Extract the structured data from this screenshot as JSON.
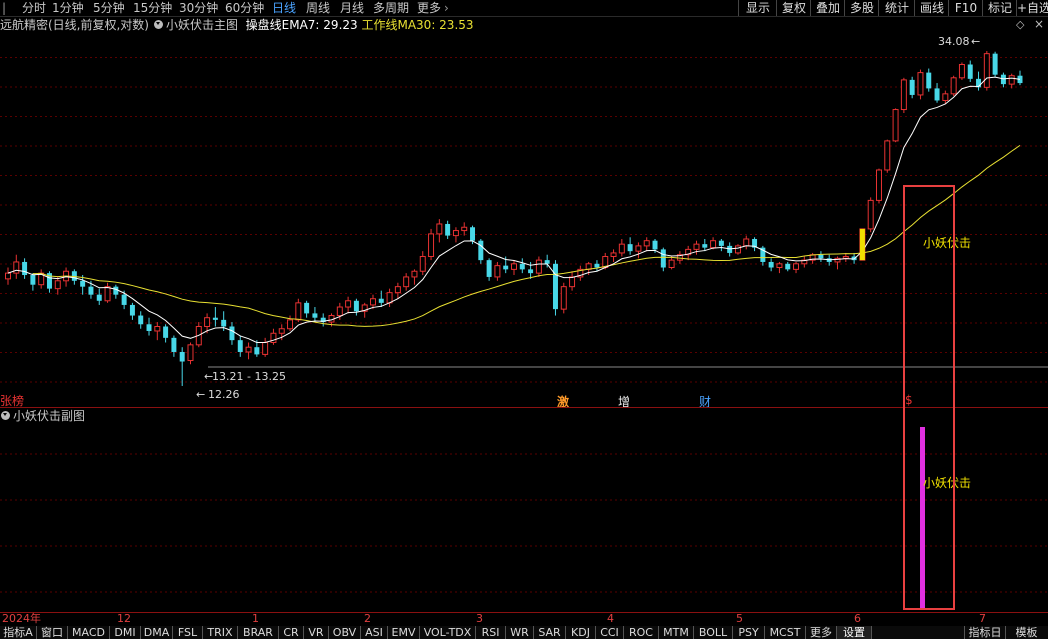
{
  "colors": {
    "up": "#e83232",
    "down": "#48d8e8",
    "ema": "#ffffff",
    "ma30": "#e8e032",
    "signal_magenta": "#e030e0",
    "signal_yellow": "#f0e000",
    "highlight_box": "#e84040",
    "grid": "#5a0000"
  },
  "topbar": {
    "periods": [
      "分时",
      "1分钟",
      "5分钟",
      "15分钟",
      "30分钟",
      "60分钟",
      "日线",
      "周线",
      "月线",
      "多周期",
      "更多"
    ],
    "active_period": "日线",
    "right_buttons": [
      "显示",
      "复权",
      "叠加",
      "多股",
      "统计",
      "画线",
      "F10",
      "标记",
      "+自选"
    ]
  },
  "info": {
    "stock": "远航精密(日线,前复权,对数)",
    "indicator": "小妖伏击主图",
    "ema_label": "操盘线EMA7: 29.23",
    "ma_label": "工作线MA30: 23.53"
  },
  "annotations": {
    "high": "34.08",
    "gap_range": "13.21 - 13.25",
    "low": "12.26",
    "signal_main": "小妖伏击",
    "signal_sub": "小妖伏击",
    "left_tag": "张榜",
    "markers": [
      "激",
      "增",
      "财",
      "$"
    ]
  },
  "subchart": {
    "title": "小妖伏击副图"
  },
  "dates": [
    "2024年",
    "12",
    "1",
    "2",
    "3",
    "4",
    "5",
    "6",
    "7"
  ],
  "bottom_tabs": [
    "指标A",
    "窗口",
    "MACD",
    "DMI",
    "DMA",
    "FSL",
    "TRIX",
    "BRAR",
    "CR",
    "VR",
    "OBV",
    "ASI",
    "EMV",
    "VOL-TDX",
    "RSI",
    "WR",
    "SAR",
    "KDJ",
    "CCI",
    "ROC",
    "MTM",
    "BOLL",
    "PSY",
    "MCST",
    "更多",
    "设置"
  ],
  "bottom_right": [
    "指标日",
    "模板"
  ],
  "chart_data": {
    "type": "candlestick",
    "scale": "log",
    "ylim": [
      12.0,
      36.0
    ],
    "series": [
      {
        "name": "操盘线EMA7",
        "last": 29.23
      },
      {
        "name": "工作线MA30",
        "last": 23.53
      }
    ],
    "candles": [
      [
        17.0,
        17.6,
        16.7,
        17.3
      ],
      [
        17.3,
        18.3,
        17.0,
        17.9
      ],
      [
        17.9,
        18.1,
        17.0,
        17.2
      ],
      [
        17.2,
        17.3,
        16.4,
        16.7
      ],
      [
        16.7,
        17.5,
        16.5,
        17.3
      ],
      [
        17.3,
        17.4,
        16.3,
        16.5
      ],
      [
        16.5,
        17.1,
        16.2,
        16.9
      ],
      [
        16.9,
        17.6,
        16.6,
        17.4
      ],
      [
        17.4,
        17.5,
        16.7,
        16.9
      ],
      [
        16.9,
        17.2,
        16.2,
        16.6
      ],
      [
        16.6,
        16.9,
        16.0,
        16.2
      ],
      [
        16.2,
        16.5,
        15.7,
        15.9
      ],
      [
        15.9,
        16.8,
        15.8,
        16.6
      ],
      [
        16.6,
        16.7,
        16.0,
        16.2
      ],
      [
        16.2,
        16.4,
        15.5,
        15.7
      ],
      [
        15.7,
        15.8,
        15.0,
        15.2
      ],
      [
        15.2,
        15.4,
        14.6,
        14.8
      ],
      [
        14.8,
        15.1,
        14.3,
        14.5
      ],
      [
        14.5,
        14.9,
        14.1,
        14.7
      ],
      [
        14.7,
        14.8,
        14.0,
        14.2
      ],
      [
        14.2,
        14.3,
        13.4,
        13.6
      ],
      [
        13.6,
        13.8,
        12.26,
        13.21
      ],
      [
        13.25,
        14.0,
        13.1,
        13.9
      ],
      [
        13.9,
        14.9,
        13.8,
        14.7
      ],
      [
        14.7,
        15.3,
        14.4,
        15.1
      ],
      [
        15.1,
        15.6,
        14.7,
        15.0
      ],
      [
        15.0,
        15.4,
        14.5,
        14.7
      ],
      [
        14.7,
        14.9,
        13.9,
        14.1
      ],
      [
        14.1,
        14.3,
        13.4,
        13.6
      ],
      [
        13.6,
        14.0,
        13.3,
        13.8
      ],
      [
        13.8,
        14.1,
        13.4,
        13.5
      ],
      [
        13.5,
        14.2,
        13.4,
        14.0
      ],
      [
        14.0,
        14.6,
        13.9,
        14.4
      ],
      [
        14.4,
        14.8,
        14.1,
        14.6
      ],
      [
        14.6,
        15.2,
        14.5,
        15.0
      ],
      [
        15.0,
        16.0,
        14.9,
        15.8
      ],
      [
        15.8,
        15.9,
        15.1,
        15.3
      ],
      [
        15.3,
        15.6,
        14.9,
        15.1
      ],
      [
        15.1,
        15.3,
        14.7,
        14.9
      ],
      [
        14.9,
        15.3,
        14.7,
        15.2
      ],
      [
        15.2,
        15.8,
        15.0,
        15.6
      ],
      [
        15.6,
        16.1,
        15.3,
        15.9
      ],
      [
        15.9,
        16.0,
        15.2,
        15.4
      ],
      [
        15.4,
        15.8,
        15.1,
        15.7
      ],
      [
        15.7,
        16.2,
        15.5,
        16.0
      ],
      [
        16.0,
        16.4,
        15.6,
        15.8
      ],
      [
        15.8,
        16.5,
        15.6,
        16.3
      ],
      [
        16.3,
        16.8,
        16.0,
        16.6
      ],
      [
        16.6,
        17.3,
        16.4,
        17.1
      ],
      [
        17.1,
        17.5,
        16.7,
        17.4
      ],
      [
        17.4,
        18.5,
        17.2,
        18.2
      ],
      [
        18.2,
        19.8,
        18.0,
        19.5
      ],
      [
        19.5,
        20.4,
        19.0,
        20.1
      ],
      [
        20.1,
        20.3,
        19.2,
        19.4
      ],
      [
        19.4,
        19.9,
        19.0,
        19.7
      ],
      [
        19.7,
        20.2,
        19.4,
        19.9
      ],
      [
        19.9,
        20.0,
        18.9,
        19.1
      ],
      [
        19.1,
        19.2,
        17.8,
        18.0
      ],
      [
        18.0,
        18.1,
        16.9,
        17.1
      ],
      [
        17.1,
        17.9,
        16.9,
        17.7
      ],
      [
        17.7,
        18.2,
        17.3,
        17.5
      ],
      [
        17.5,
        18.0,
        17.2,
        17.8
      ],
      [
        17.8,
        18.1,
        17.3,
        17.5
      ],
      [
        17.5,
        17.9,
        17.0,
        17.3
      ],
      [
        17.3,
        18.2,
        17.1,
        18.0
      ],
      [
        18.0,
        18.3,
        17.6,
        17.8
      ],
      [
        17.8,
        18.0,
        15.2,
        15.5
      ],
      [
        15.5,
        16.8,
        15.3,
        16.6
      ],
      [
        16.6,
        17.4,
        16.4,
        17.1
      ],
      [
        17.1,
        17.7,
        16.9,
        17.5
      ],
      [
        17.5,
        17.9,
        17.2,
        17.8
      ],
      [
        17.8,
        18.0,
        17.4,
        17.6
      ],
      [
        17.6,
        18.4,
        17.5,
        18.2
      ],
      [
        18.2,
        18.6,
        17.9,
        18.4
      ],
      [
        18.4,
        19.2,
        18.2,
        18.9
      ],
      [
        18.9,
        19.3,
        18.3,
        18.5
      ],
      [
        18.5,
        19.0,
        18.1,
        18.8
      ],
      [
        18.8,
        19.3,
        18.5,
        19.1
      ],
      [
        19.1,
        19.2,
        18.4,
        18.6
      ],
      [
        18.6,
        18.7,
        17.4,
        17.6
      ],
      [
        17.6,
        18.2,
        17.5,
        18.0
      ],
      [
        18.0,
        18.5,
        17.8,
        18.3
      ],
      [
        18.3,
        18.8,
        18.0,
        18.6
      ],
      [
        18.6,
        19.1,
        18.3,
        18.9
      ],
      [
        18.9,
        19.2,
        18.5,
        18.7
      ],
      [
        18.7,
        19.3,
        18.6,
        19.1
      ],
      [
        19.1,
        19.2,
        18.5,
        18.8
      ],
      [
        18.8,
        19.0,
        18.2,
        18.4
      ],
      [
        18.4,
        18.9,
        18.3,
        18.8
      ],
      [
        18.8,
        19.4,
        18.6,
        19.2
      ],
      [
        19.2,
        19.3,
        18.5,
        18.7
      ],
      [
        18.7,
        18.8,
        17.7,
        17.9
      ],
      [
        17.9,
        18.1,
        17.4,
        17.6
      ],
      [
        17.6,
        17.9,
        17.3,
        17.8
      ],
      [
        17.8,
        17.9,
        17.4,
        17.5
      ],
      [
        17.5,
        17.9,
        17.3,
        17.8
      ],
      [
        17.8,
        18.2,
        17.6,
        18.0
      ],
      [
        18.0,
        18.4,
        17.8,
        18.3
      ],
      [
        18.3,
        18.5,
        17.9,
        18.1
      ],
      [
        18.1,
        18.3,
        17.7,
        17.9
      ],
      [
        17.9,
        18.2,
        17.5,
        18.1
      ],
      [
        18.1,
        18.4,
        17.9,
        18.2
      ],
      [
        18.2,
        18.4,
        17.8,
        18.0
      ],
      [
        18.0,
        19.8,
        18.0,
        19.8
      ],
      [
        19.8,
        21.8,
        19.6,
        21.6
      ],
      [
        21.6,
        23.8,
        21.4,
        23.7
      ],
      [
        23.7,
        26.0,
        23.5,
        25.9
      ],
      [
        25.9,
        28.6,
        25.8,
        28.5
      ],
      [
        28.5,
        31.4,
        28.2,
        31.2
      ],
      [
        31.2,
        31.5,
        29.5,
        29.8
      ],
      [
        29.8,
        32.2,
        29.4,
        31.9
      ],
      [
        31.9,
        32.3,
        30.1,
        30.4
      ],
      [
        30.4,
        30.9,
        29.1,
        29.3
      ],
      [
        29.3,
        30.2,
        29.0,
        29.9
      ],
      [
        29.9,
        31.6,
        29.7,
        31.4
      ],
      [
        31.4,
        32.9,
        31.2,
        32.7
      ],
      [
        32.7,
        33.1,
        31.0,
        31.3
      ],
      [
        31.3,
        32.0,
        30.2,
        30.5
      ],
      [
        30.5,
        34.08,
        30.2,
        33.8
      ],
      [
        33.8,
        34.0,
        31.5,
        31.7
      ],
      [
        31.7,
        31.9,
        30.5,
        30.8
      ],
      [
        30.8,
        31.8,
        30.4,
        31.6
      ],
      [
        31.6,
        32.1,
        30.7,
        30.9
      ]
    ]
  }
}
